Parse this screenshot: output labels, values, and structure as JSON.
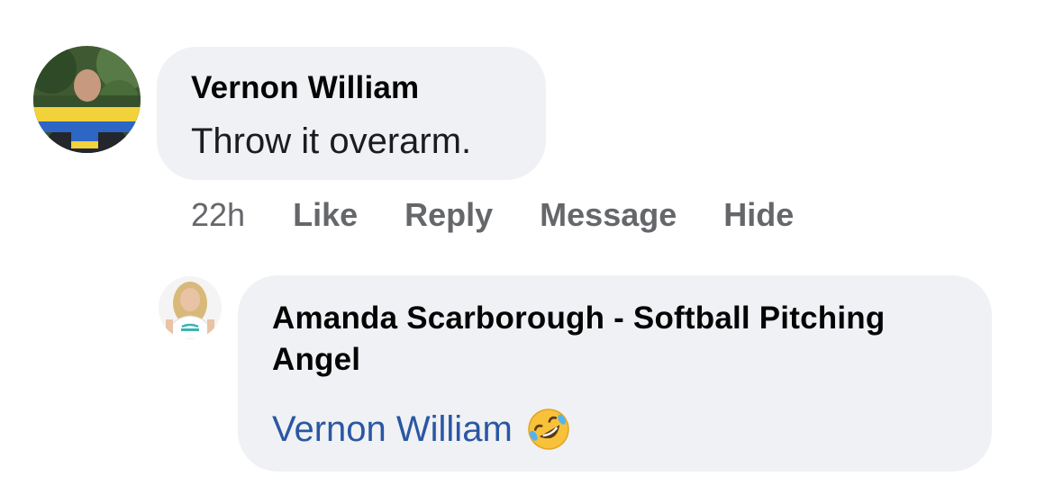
{
  "comment": {
    "author": "Vernon William",
    "text": "Throw it overarm.",
    "time": "22h",
    "actions": [
      "Like",
      "Reply",
      "Message",
      "Hide"
    ]
  },
  "reply": {
    "author": "Amanda Scarborough - Softball Pitching Angel",
    "mention": "Vernon William",
    "emoji": "rolling-on-floor-laughing-emoji"
  },
  "colors": {
    "bubble": "#f0f1f4",
    "mention": "#2a57a3",
    "meta": "#65676b"
  }
}
